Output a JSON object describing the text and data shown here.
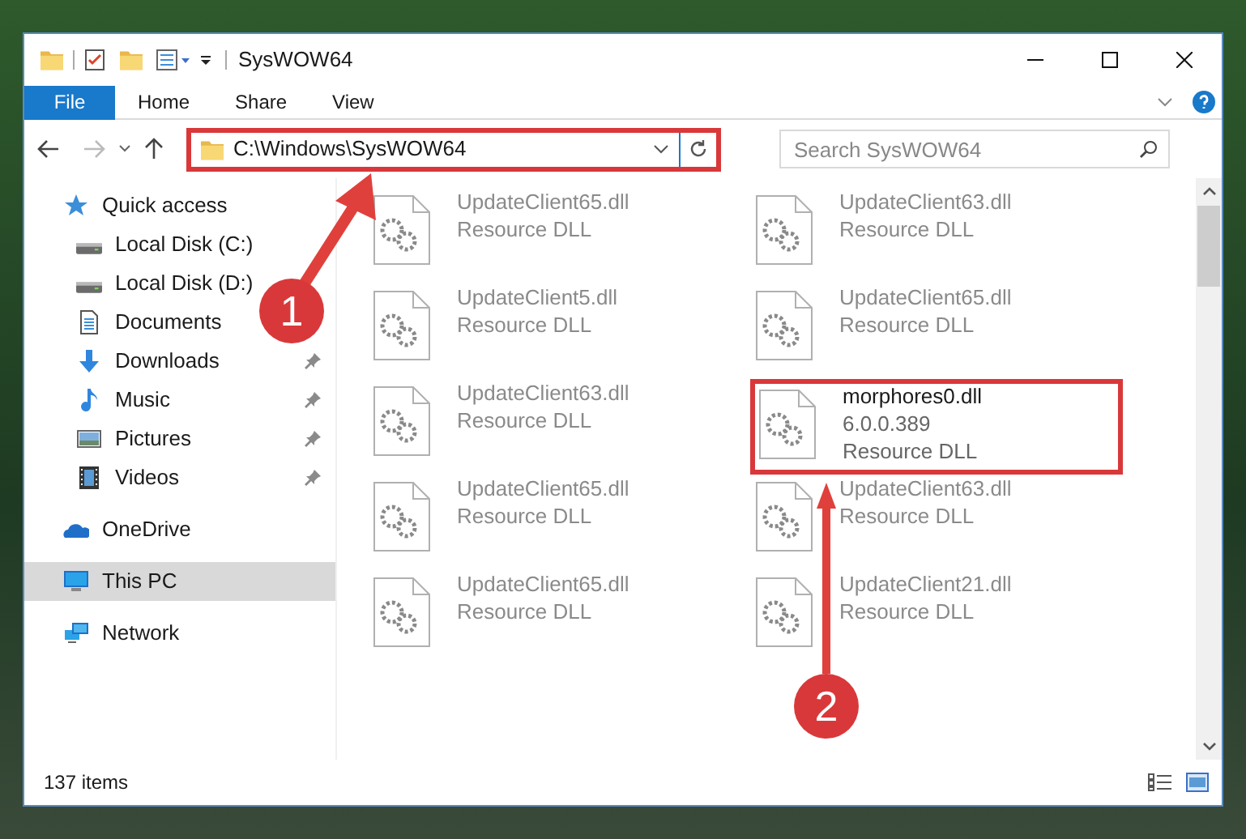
{
  "window": {
    "title": "SysWOW64"
  },
  "ribbon_tabs": [
    {
      "label": "File",
      "kind": "file"
    },
    {
      "label": "Home",
      "kind": "tab"
    },
    {
      "label": "Share",
      "kind": "tab"
    },
    {
      "label": "View",
      "kind": "tab"
    }
  ],
  "address": {
    "path": "C:\\Windows\\SysWOW64",
    "highlighted": true
  },
  "search": {
    "placeholder": "Search SysWOW64"
  },
  "sidebar": {
    "items": [
      {
        "label": "Quick access",
        "kind": "star",
        "selected": false,
        "children": [
          {
            "label": "Local Disk (C:)",
            "kind": "disk",
            "pinned": false,
            "selected": false
          },
          {
            "label": "Local Disk (D:)",
            "kind": "disk",
            "pinned": false,
            "selected": false
          },
          {
            "label": "Documents",
            "kind": "document",
            "pinned": false,
            "selected": false
          },
          {
            "label": "Downloads",
            "kind": "download",
            "pinned": true,
            "selected": false
          },
          {
            "label": "Music",
            "kind": "music",
            "pinned": true,
            "selected": false
          },
          {
            "label": "Pictures",
            "kind": "picture",
            "pinned": true,
            "selected": false
          },
          {
            "label": "Videos",
            "kind": "video",
            "pinned": true,
            "selected": false
          }
        ]
      },
      {
        "label": "OneDrive",
        "kind": "cloud",
        "selected": false
      },
      {
        "label": "This PC",
        "kind": "monitor",
        "selected": true
      },
      {
        "label": "Network",
        "kind": "network",
        "selected": false
      }
    ]
  },
  "files": [
    {
      "name": "UpdateClient65.dll",
      "type": "Resource DLL",
      "dimmed": true,
      "highlighted": false
    },
    {
      "name": "UpdateClient63.dll",
      "type": "Resource DLL",
      "dimmed": true,
      "highlighted": false
    },
    {
      "name": "UpdateClient5.dll",
      "type": "Resource DLL",
      "dimmed": true,
      "highlighted": false
    },
    {
      "name": "UpdateClient65.dll",
      "type": "Resource DLL",
      "dimmed": true,
      "highlighted": false
    },
    {
      "name": "UpdateClient63.dll",
      "type": "Resource DLL",
      "dimmed": true,
      "highlighted": false
    },
    {
      "name": "morphores0.dll",
      "version": "6.0.0.389",
      "type": "Resource DLL",
      "dimmed": false,
      "highlighted": true
    },
    {
      "name": "UpdateClient65.dll",
      "type": "Resource DLL",
      "dimmed": true,
      "highlighted": false
    },
    {
      "name": "UpdateClient63.dll",
      "type": "Resource DLL",
      "dimmed": true,
      "highlighted": false
    },
    {
      "name": "UpdateClient65.dll",
      "type": "Resource DLL",
      "dimmed": true,
      "highlighted": false
    },
    {
      "name": "UpdateClient21.dll",
      "type": "Resource DLL",
      "dimmed": true,
      "highlighted": false
    }
  ],
  "status_bar": {
    "item_count": "137 items"
  },
  "annotations": [
    {
      "label": "1"
    },
    {
      "label": "2"
    }
  ]
}
